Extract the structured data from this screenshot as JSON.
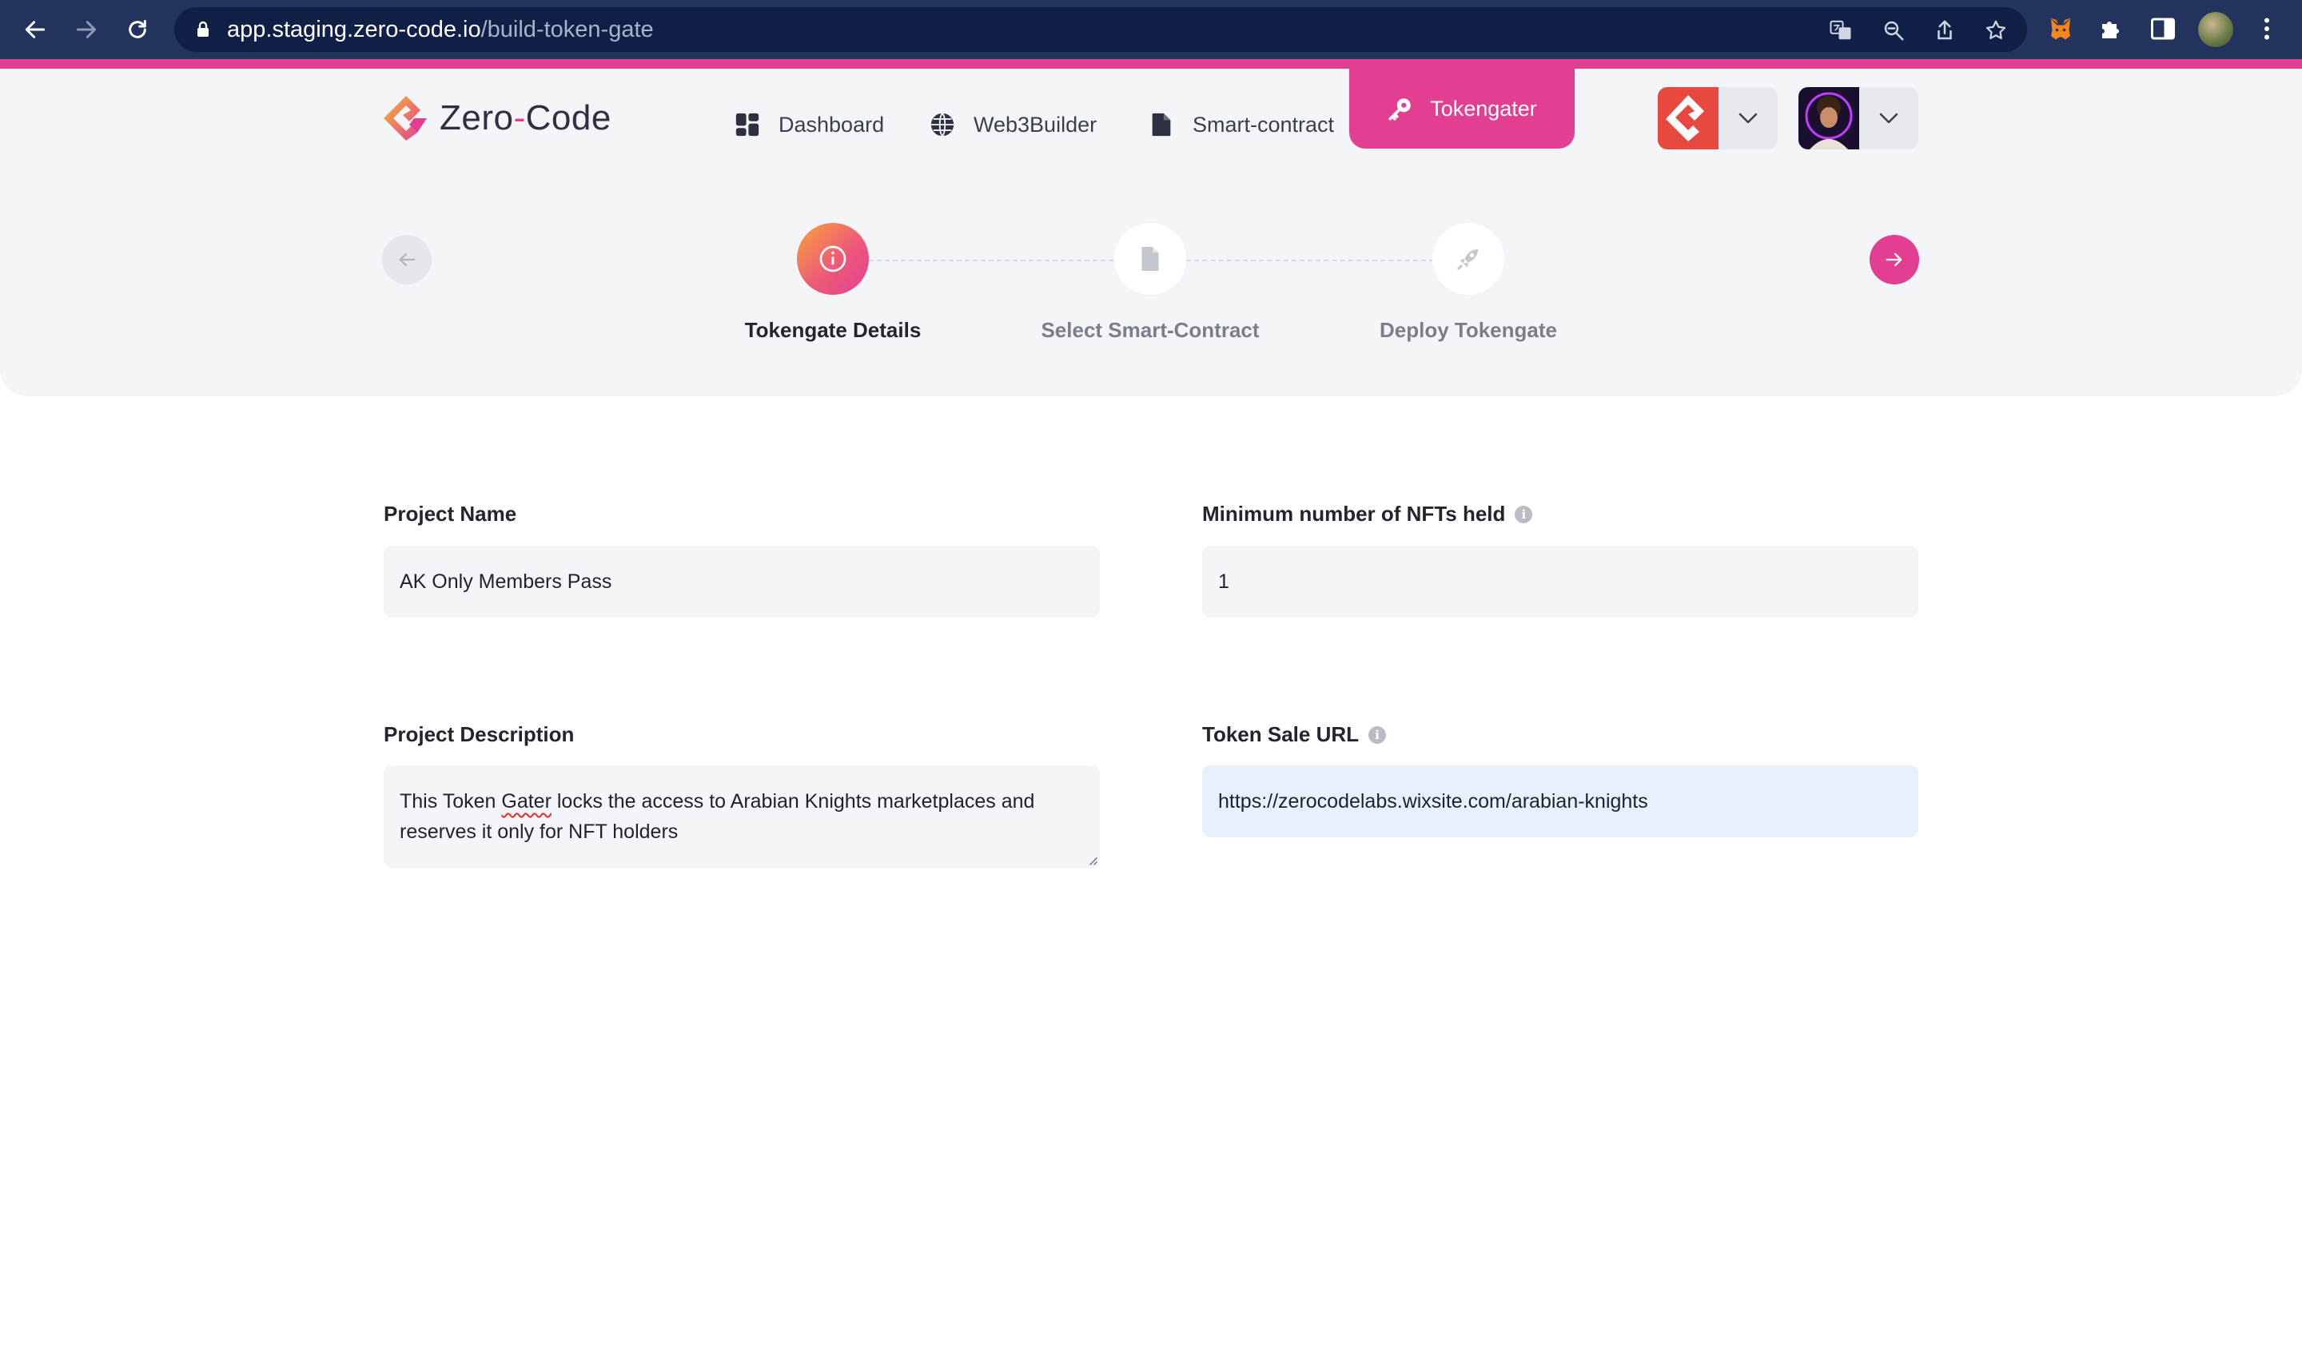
{
  "browser": {
    "url_host": "app.staging.zero-code.io",
    "url_path": "/build-token-gate"
  },
  "app": {
    "logo_prefix": "Zero",
    "logo_dash": "-",
    "logo_suffix": "Code",
    "brand_color": "#e23f93",
    "nav": [
      {
        "label": "Dashboard",
        "icon": "dashboard-icon"
      },
      {
        "label": "Web3Builder",
        "icon": "globe-icon"
      },
      {
        "label": "Smart-contract",
        "icon": "document-icon"
      },
      {
        "label": "Tokengater",
        "icon": "key-icon",
        "active": true
      }
    ]
  },
  "stepper": {
    "steps": [
      {
        "label": "Tokengate Details",
        "icon": "info-icon",
        "active": true
      },
      {
        "label": "Select Smart-Contract",
        "icon": "document-icon",
        "active": false
      },
      {
        "label": "Deploy Tokengate",
        "icon": "rocket-icon",
        "active": false
      }
    ]
  },
  "form": {
    "project_name": {
      "label": "Project Name",
      "value": "AK Only Members Pass"
    },
    "min_nfts": {
      "label": "Minimum number of NFTs held",
      "value": "1",
      "info_icon": "i"
    },
    "project_description": {
      "label": "Project Description",
      "value_part1": "This Token ",
      "value_misspelled": "Gater",
      "value_part2": " locks the access to Arabian Knights marketplaces and reserves it only for NFT holders"
    },
    "token_sale_url": {
      "label": "Token Sale URL",
      "value": "https://zerocodelabs.wixsite.com/arabian-knights",
      "info_icon": "i"
    }
  }
}
